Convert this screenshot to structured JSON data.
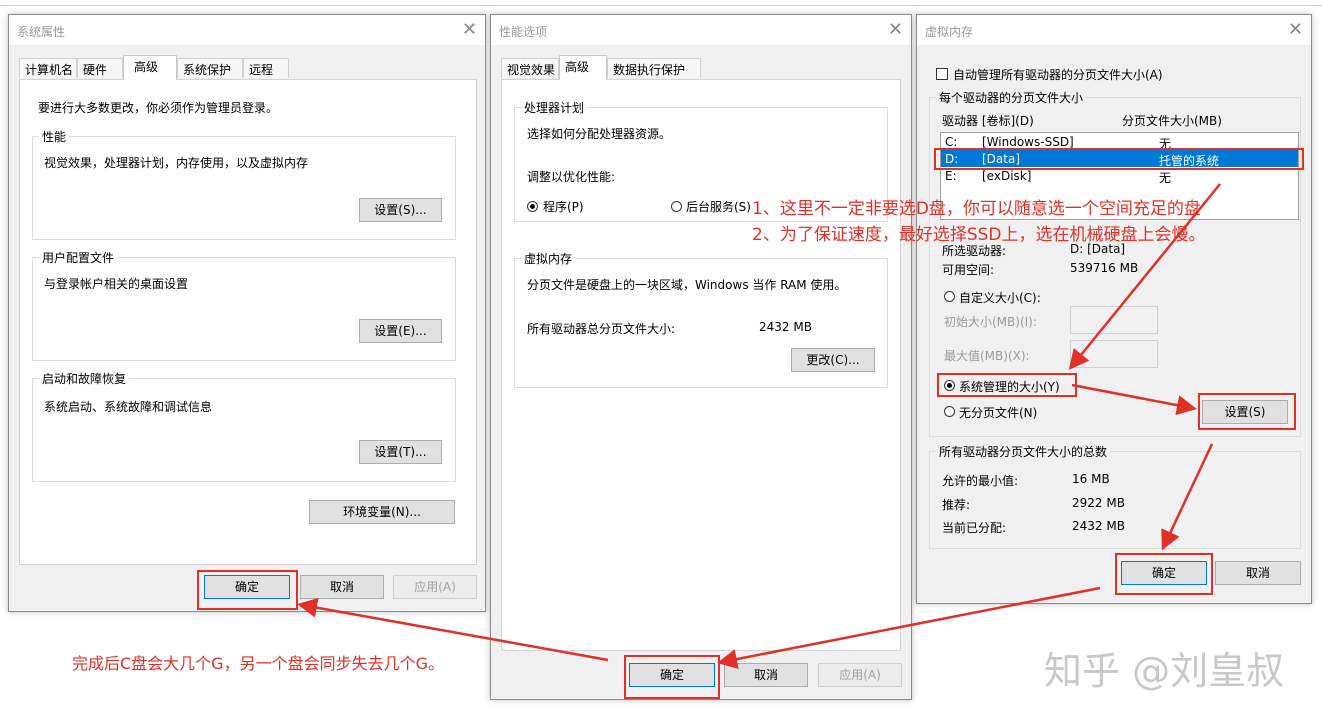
{
  "dialog1": {
    "title": "系统属性",
    "tabs": [
      "计算机名",
      "硬件",
      "高级",
      "系统保护",
      "远程"
    ],
    "admin_note": "要进行大多数更改，你必须作为管理员登录。",
    "perf": {
      "label": "性能",
      "desc": "视觉效果，处理器计划，内存使用，以及虚拟内存",
      "btn": "设置(S)..."
    },
    "profile": {
      "label": "用户配置文件",
      "desc": "与登录帐户相关的桌面设置",
      "btn": "设置(E)..."
    },
    "startup": {
      "label": "启动和故障恢复",
      "desc": "系统启动、系统故障和调试信息",
      "btn": "设置(T)..."
    },
    "env_btn": "环境变量(N)...",
    "ok": "确定",
    "cancel": "取消",
    "apply": "应用(A)"
  },
  "dialog2": {
    "title": "性能选项",
    "tabs": [
      "视觉效果",
      "高级",
      "数据执行保护"
    ],
    "cpu": {
      "label": "处理器计划",
      "desc": "选择如何分配处理器资源。",
      "adjust": "调整以优化性能:",
      "opt_programs": "程序(P)",
      "opt_services": "后台服务(S)"
    },
    "vm": {
      "label": "虚拟内存",
      "desc": "分页文件是硬盘上的一块区域，Windows 当作 RAM 使用。",
      "total_label": "所有驱动器总分页文件大小:",
      "total_value": "2432 MB",
      "btn": "更改(C)..."
    },
    "ok": "确定",
    "cancel": "取消",
    "apply": "应用(A)"
  },
  "dialog3": {
    "title": "虚拟内存",
    "auto_manage": "自动管理所有驱动器的分页文件大小(A)",
    "per_drive_label": "每个驱动器的分页文件大小",
    "col_drive": "驱动器 [卷标](D)",
    "col_size": "分页文件大小(MB)",
    "drives": [
      {
        "drive": "C:",
        "label": "[Windows-SSD]",
        "size": "无"
      },
      {
        "drive": "D:",
        "label": "[Data]",
        "size": "托管的系统"
      },
      {
        "drive": "E:",
        "label": "[exDisk]",
        "size": "无"
      }
    ],
    "selected_drive_label": "所选驱动器:",
    "selected_drive_value": "D:  [Data]",
    "free_label": "可用空间:",
    "free_value": "539716 MB",
    "custom_size": "自定义大小(C):",
    "initial_size": "初始大小(MB)(I):",
    "max_size": "最大值(MB)(X):",
    "system_managed": "系统管理的大小(Y)",
    "no_paging": "无分页文件(N)",
    "set_btn": "设置(S)",
    "totals_label": "所有驱动器分页文件大小的总数",
    "min_label": "允许的最小值:",
    "min_value": "16 MB",
    "rec_label": "推荐:",
    "rec_value": "2922 MB",
    "cur_label": "当前已分配:",
    "cur_value": "2432 MB",
    "ok": "确定",
    "cancel": "取消"
  },
  "annotations": {
    "note1": "1、这里不一定非要选D盘，你可以随意选一个空间充足的盘",
    "note2": "2、为了保证速度，最好选择SSD上，选在机械硬盘上会慢。",
    "bottom": "完成后C盘会大几个G，另一个盘会同步失去几个G。"
  },
  "watermark": "知乎 @刘皇叔",
  "colors": {
    "annotation": "#e0302a",
    "selection": "#0078d7"
  }
}
